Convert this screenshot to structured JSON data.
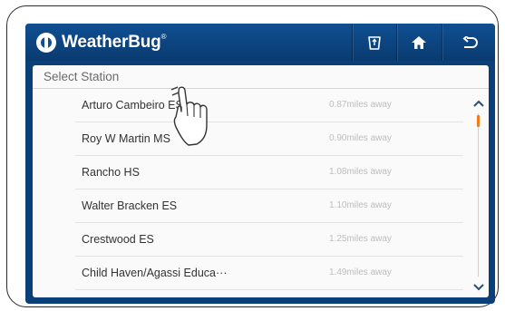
{
  "app": {
    "brand": "WeatherBug",
    "brand_mark": "®"
  },
  "header": {
    "buttons": [
      {
        "icon": "share-icon"
      },
      {
        "icon": "home-icon"
      },
      {
        "icon": "back-arrow-icon"
      }
    ]
  },
  "panel": {
    "title": "Select Station"
  },
  "stations": [
    {
      "name": "Arturo Cambeiro ES",
      "distance": "0.87miles away"
    },
    {
      "name": "Roy W Martin MS",
      "distance": "0.90miles away"
    },
    {
      "name": "Rancho HS",
      "distance": "1.08miles away"
    },
    {
      "name": "Walter Bracken ES",
      "distance": "1.10miles away"
    },
    {
      "name": "Crestwood ES",
      "distance": "1.25miles away"
    },
    {
      "name": "Child Haven/Agassi Educa···",
      "distance": "1.49miles away"
    }
  ],
  "scroll": {
    "position_fraction": 0.0
  },
  "colors": {
    "header": "#0f4f92",
    "accent": "#ef7b1a",
    "panel": "#fafafa"
  }
}
